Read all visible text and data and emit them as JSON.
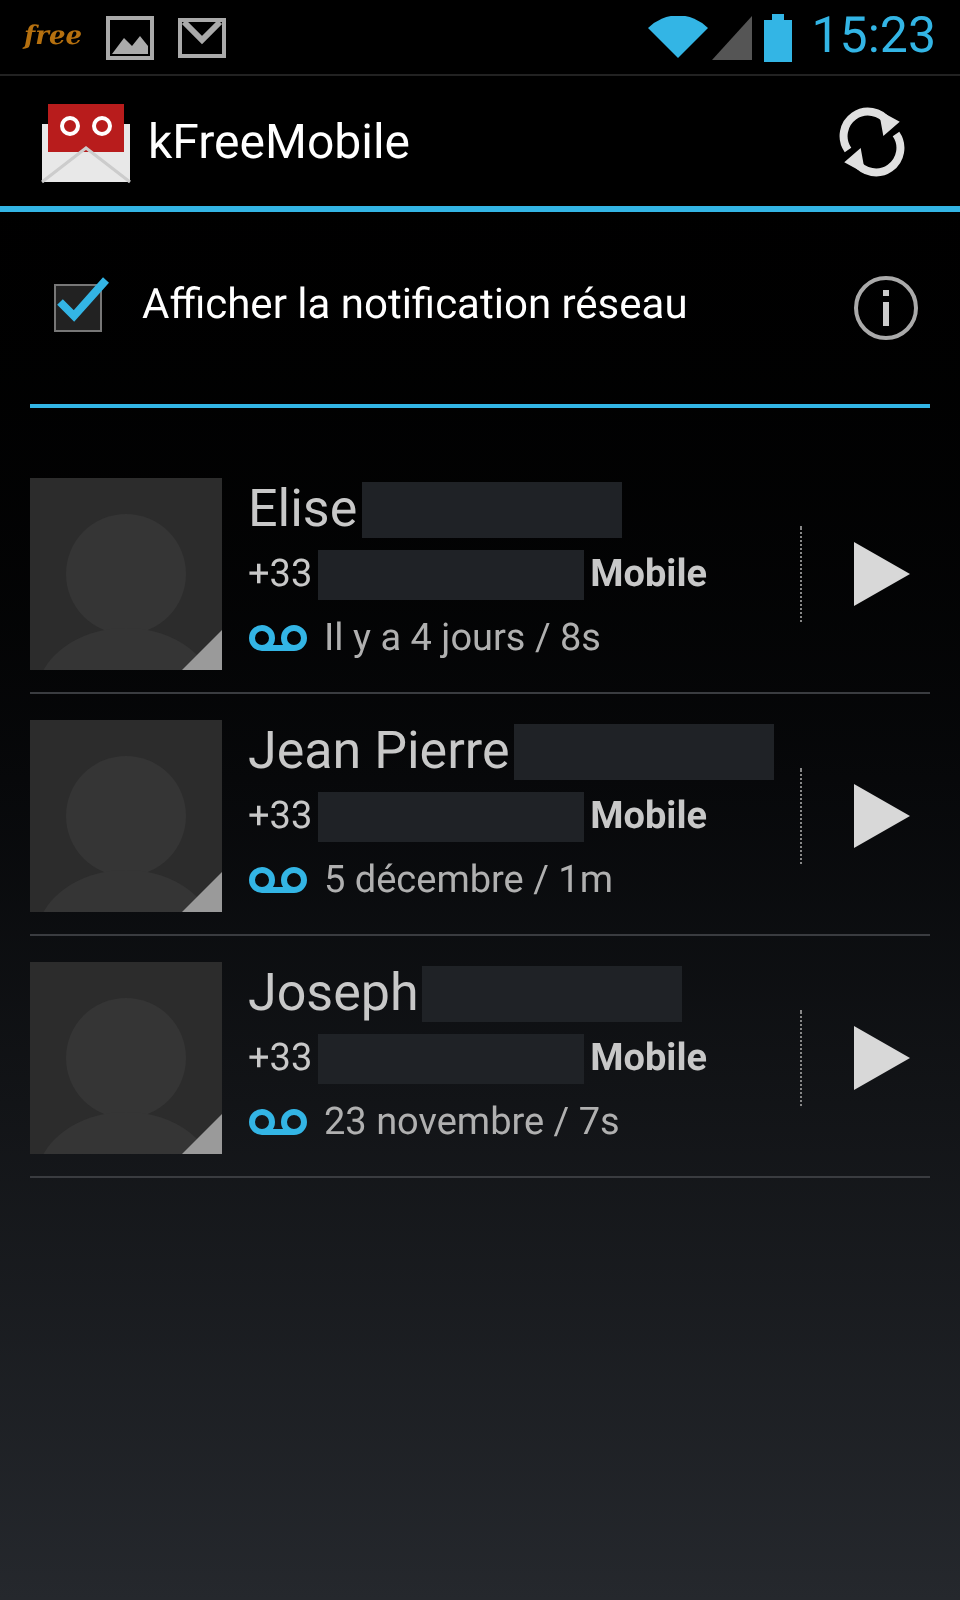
{
  "status_bar": {
    "carrier": "free",
    "time": "15:23"
  },
  "action_bar": {
    "title": "kFreeMobile"
  },
  "setting": {
    "label": "Afficher la notification réseau",
    "checked": true
  },
  "messages": [
    {
      "name": "Elise",
      "number": "+33",
      "number_type": "Mobile",
      "when": "Il y a 4 jours / 8s"
    },
    {
      "name": "Jean Pierre",
      "number": "+33",
      "number_type": "Mobile",
      "when": "5 décembre / 1m"
    },
    {
      "name": "Joseph",
      "number": "+33",
      "number_type": "Mobile",
      "when": "23 novembre / 7s"
    }
  ]
}
